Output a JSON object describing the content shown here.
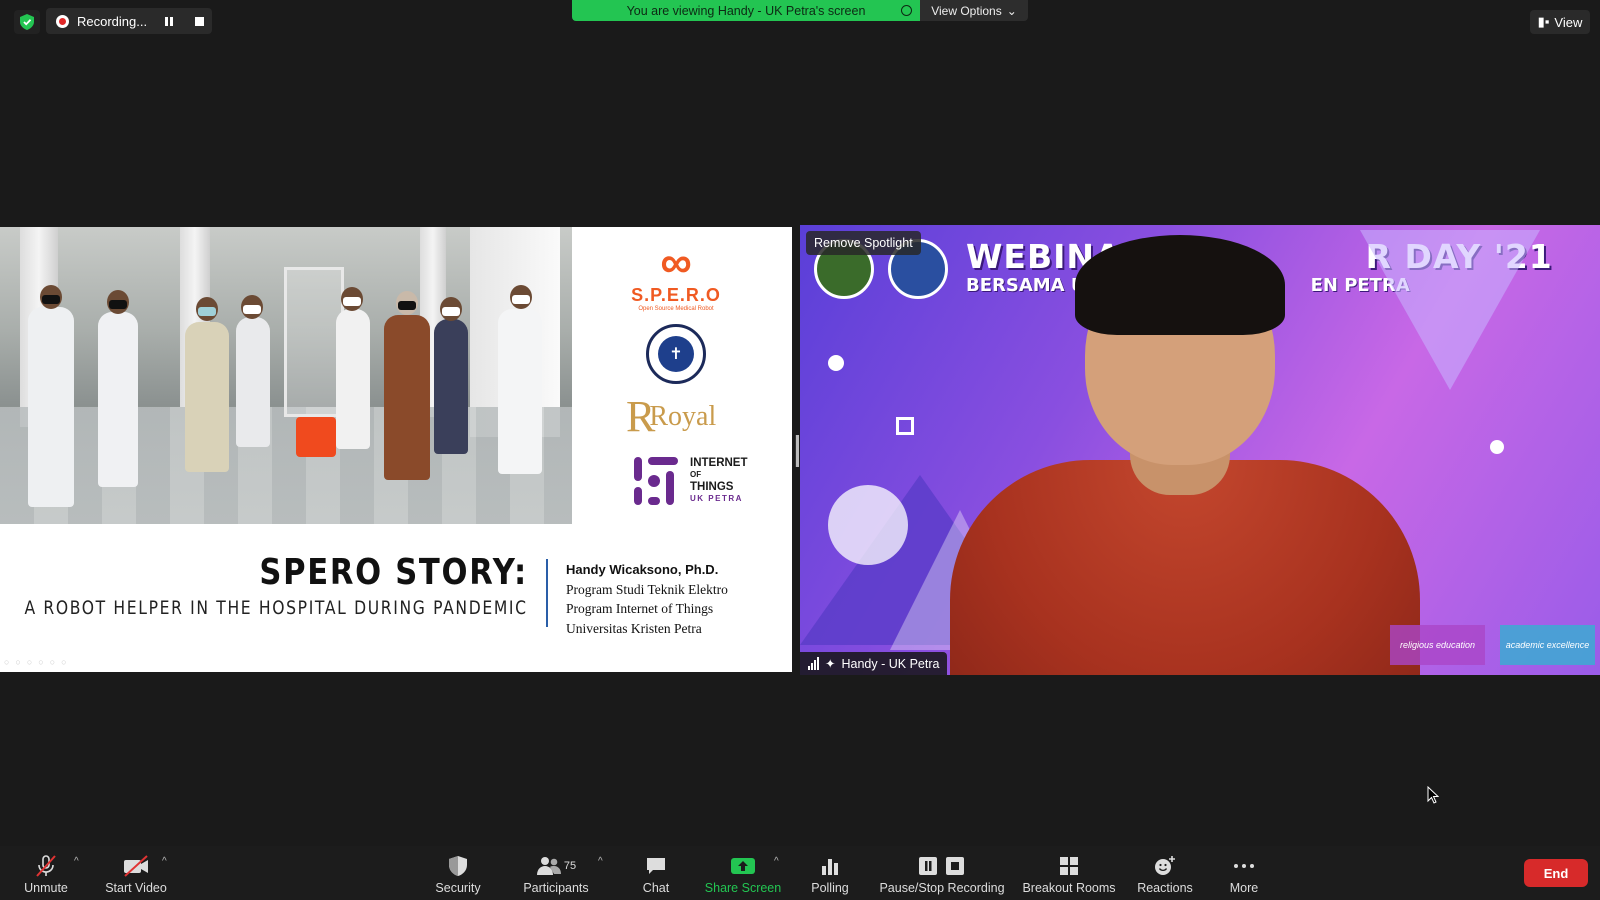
{
  "top_bar": {
    "recording_label": "Recording...",
    "banner_text": "You are viewing Handy - UK Petra's screen",
    "view_options_label": "View Options",
    "view_label": "View"
  },
  "shared_slide": {
    "spero_logo_name": "S.P.E.R.O",
    "spero_logo_tagline": "Open Source Medical Robot",
    "royal_logo_text": "Royal",
    "iot_logo_line1": "INTERNET",
    "iot_logo_line2": "OF",
    "iot_logo_line3": "THINGS",
    "iot_logo_line4": "UK PETRA",
    "title": "SPERO STORY:",
    "subtitle": "A ROBOT HELPER IN THE HOSPITAL DURING PANDEMIC",
    "author_name": "Handy Wicaksono, Ph.D.",
    "author_line2": "Program Studi Teknik Elektro",
    "author_line3": "Program Internet of Things",
    "author_line4": "Universitas Kristen Petra"
  },
  "video_tile": {
    "remove_spotlight_label": "Remove Spotlight",
    "participant_name": "Handy - UK Petra",
    "background_title_visible_1": "WEBINAR C",
    "background_title_visible_2": "R DAY '21",
    "background_sub_visible_1": "BERSAMA UN",
    "background_sub_visible_2": "EN PETRA",
    "badge_religious": "religious education",
    "badge_academic": "academic excellence"
  },
  "toolbar": {
    "unmute_label": "Unmute",
    "start_video_label": "Start Video",
    "security_label": "Security",
    "participants_label": "Participants",
    "participants_count": "75",
    "chat_label": "Chat",
    "share_screen_label": "Share Screen",
    "polling_label": "Polling",
    "pause_stop_recording_label": "Pause/Stop Recording",
    "breakout_rooms_label": "Breakout Rooms",
    "reactions_label": "Reactions",
    "more_label": "More",
    "end_label": "End"
  },
  "colors": {
    "banner_green": "#23c552",
    "share_green": "#23c552",
    "end_red": "#d72a2a",
    "spero_orange": "#f05a22",
    "iot_purple": "#6a2a8e"
  }
}
